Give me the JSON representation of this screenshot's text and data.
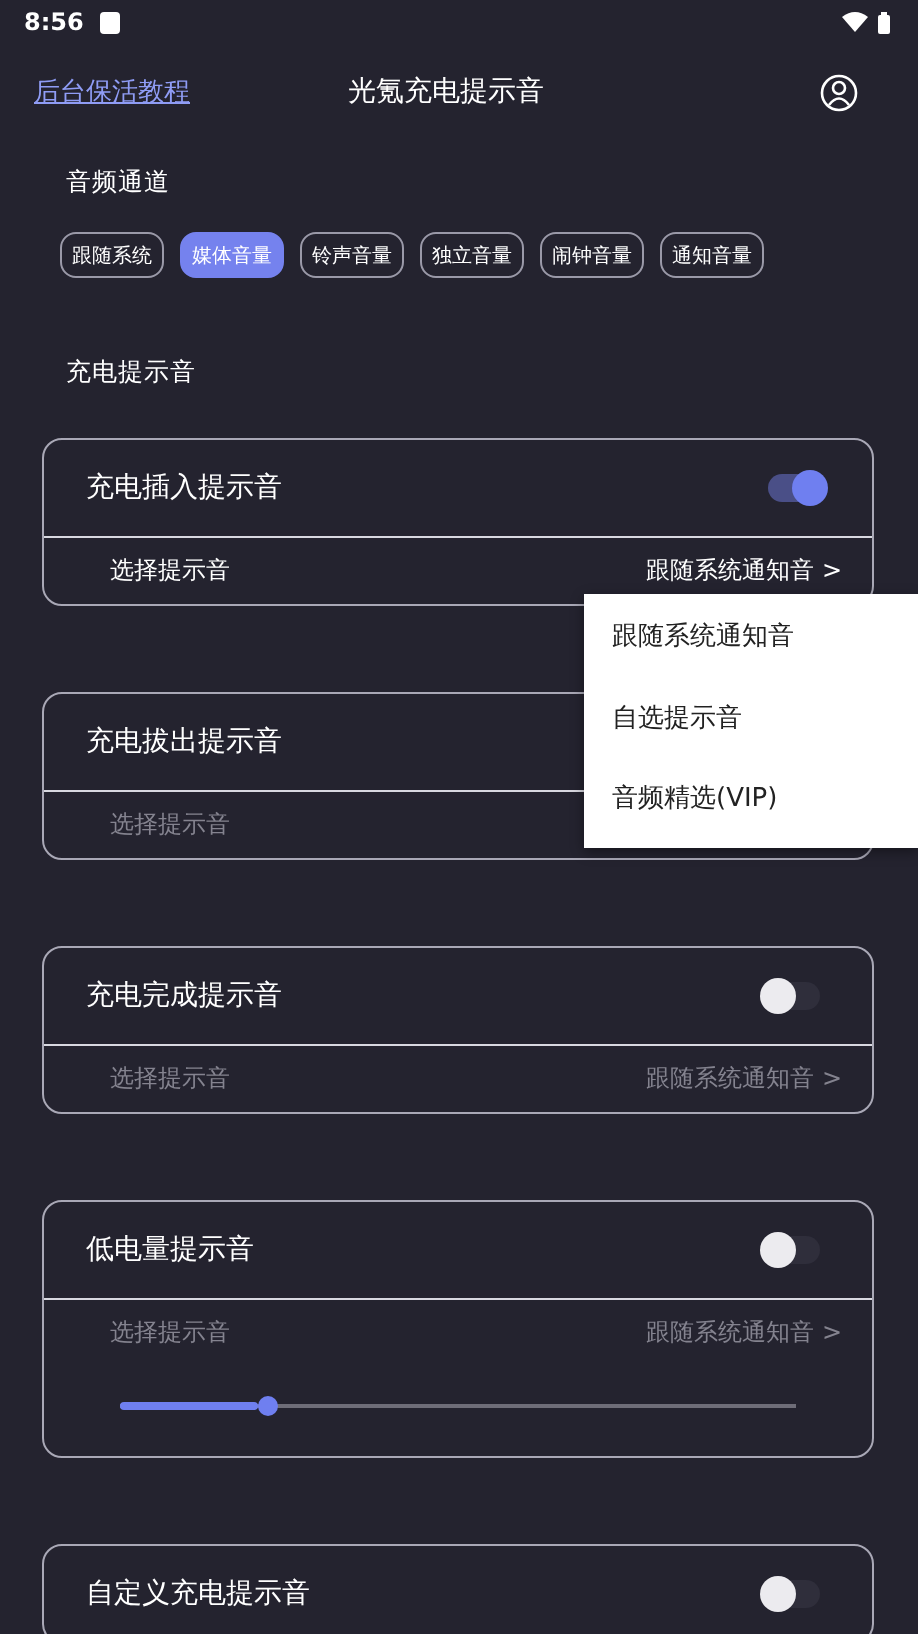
{
  "status_bar": {
    "time": "8:56"
  },
  "header": {
    "link": "后台保活教程",
    "title": "光氪充电提示音"
  },
  "channel_section": {
    "title": "音频通道",
    "chips": [
      {
        "label": "跟随系统",
        "selected": false
      },
      {
        "label": "媒体音量",
        "selected": true
      },
      {
        "label": "铃声音量",
        "selected": false
      },
      {
        "label": "独立音量",
        "selected": false
      },
      {
        "label": "闹钟音量",
        "selected": false
      },
      {
        "label": "通知音量",
        "selected": false
      }
    ]
  },
  "sound_section": {
    "title": "充电提示音"
  },
  "cards": [
    {
      "kind": "option",
      "title": "充电插入提示音",
      "on": true,
      "option_label": "选择提示音",
      "option_value": "跟随系统通知音 >",
      "option_disabled": false
    },
    {
      "kind": "option",
      "title": "充电拔出提示音",
      "option_label": "选择提示音",
      "option_disabled": true
    },
    {
      "kind": "option",
      "title": "充电完成提示音",
      "on": false,
      "option_label": "选择提示音",
      "option_value": "跟随系统通知音 >",
      "option_disabled": true
    },
    {
      "kind": "slider",
      "title": "低电量提示音",
      "on": false,
      "option_label": "选择提示音",
      "option_value": "跟随系统通知音 >",
      "option_disabled": true,
      "level": 0.22
    },
    {
      "kind": "plain",
      "title": "自定义充电提示音",
      "on": false
    }
  ],
  "menu": {
    "items": [
      "跟随系统通知音",
      "自选提示音",
      "音频精选(VIP)"
    ]
  }
}
